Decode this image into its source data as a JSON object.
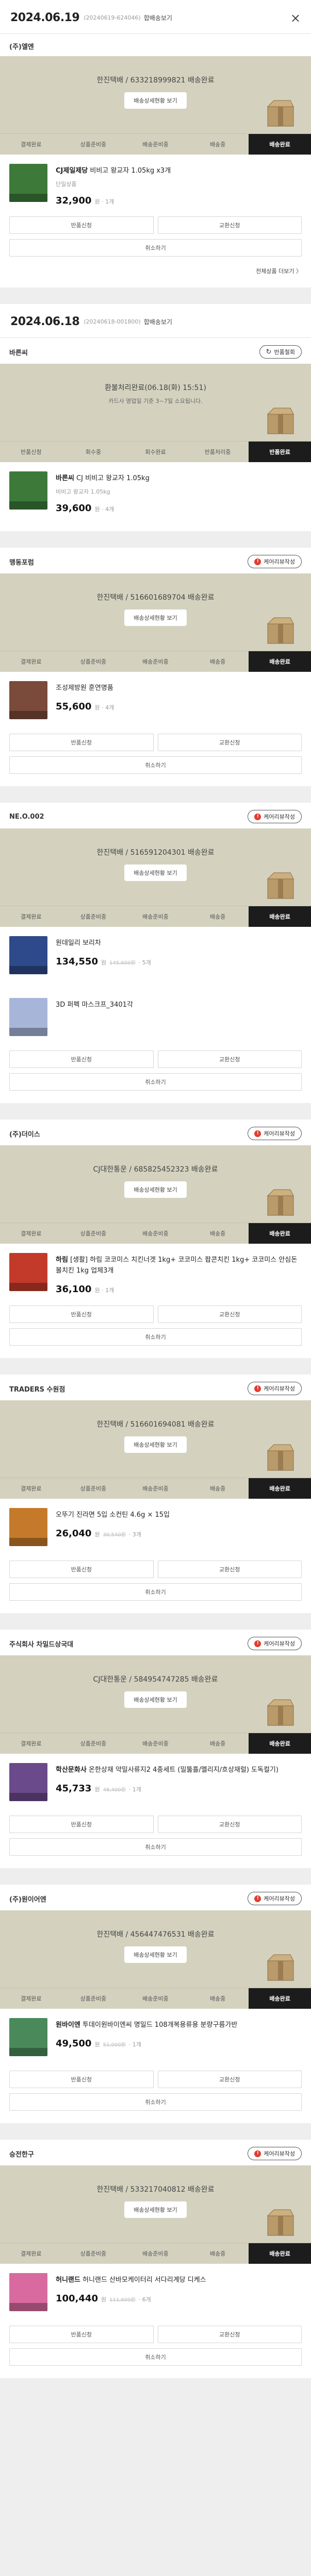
{
  "colors": {
    "banner": "#d4d2bf",
    "active_step": "#1c1c1c",
    "badge": "#e33b2e"
  },
  "orders": [
    {
      "date": "2024.06.19",
      "order_no": "(20240619-624046)",
      "detail_label": "합배송보기",
      "close_icon": "×",
      "seller": "(주)엘엔",
      "banner_status": "한진택배 / 633218999821 배송완료",
      "banner_button": "배송상세현황 보기",
      "steps": [
        "결제완료",
        "상품준비중",
        "배송준비중",
        "배송중",
        "배송완료"
      ],
      "item_name_bold": "CJ제일제당",
      "item_name": "비비고 왕교자 1.05kg x3개",
      "item_option": "단일상품",
      "item_price": "32,900",
      "item_unit": "원 · 1개",
      "btn_return": "반품신청",
      "btn_exchange": "교환신청",
      "btn_cancel": "취소하기",
      "more_link": "전체상품 더보기 〉",
      "thumb_color": "#3d7a3a"
    },
    {
      "date": "2024.06.18",
      "order_no": "(20240618-001800)",
      "detail_label": "합배송보기",
      "chip_label": "반품철회",
      "seller": "바른씨",
      "banner_status": "환불처리완료(06.18(화) 15:51)",
      "banner_sub": "카드사 영업일 기준 3~7일 소요됩니다.",
      "steps": [
        "반품신청",
        "회수중",
        "회수완료",
        "반품처리중",
        "반품완료"
      ],
      "item_name_bold": "바른씨",
      "item_name": "CJ 비비고 왕교자 1.05kg",
      "item_option": "비비고 왕교자 1.05kg",
      "item_price": "39,600",
      "item_unit": "원 · 4개",
      "thumb_color": "#3d7a3a"
    },
    {
      "seller": "맹동포럼",
      "chip_label": "케어리뷰작성",
      "banner_status": "한진택배 / 516601689704 배송완료",
      "banner_button": "배송상세현황 보기",
      "steps": [
        "결제완료",
        "상품준비중",
        "배송준비중",
        "배송중",
        "배송완료"
      ],
      "item_name": "조성제방원 훈연명품",
      "item_price": "55,600",
      "item_unit": "원 · 4개",
      "btn_return": "반품신청",
      "btn_exchange": "교환신청",
      "btn_cancel": "취소하기",
      "thumb_color": "#7a4a3a"
    },
    {
      "seller": "NE.O.002",
      "chip_label": "케어리뷰작성",
      "banner_status": "한진택배 / 516591204301 배송완료",
      "banner_button": "배송상세현황 보기",
      "steps": [
        "결제완료",
        "상품준비중",
        "배송준비중",
        "배송중",
        "배송완료"
      ],
      "item_name": "원데일리 보리차",
      "item_price": "134,550",
      "item_unit": "원",
      "item_orig": "145,600원",
      "item_unit2": "· 5개",
      "item2_name": "3D 퍼펙 마스크프_3401각",
      "btn_return": "반품신청",
      "btn_exchange": "교환신청",
      "btn_cancel": "취소하기",
      "thumb_color": "#2f4a8a",
      "thumb2_color": "#a7b6d8"
    },
    {
      "seller": "(주)더이스",
      "chip_label": "케어리뷰작성",
      "banner_status": "CJ대한통운 / 685825452323 배송완료",
      "banner_button": "배송상세현황 보기",
      "steps": [
        "결제완료",
        "상품준비중",
        "배송준비중",
        "배송중",
        "배송완료"
      ],
      "item_name_bold": "하림",
      "item_name": "[생활] 하림 코코미스 치킨너겟 1kg+ 코코미스 팝콘치킨 1kg+ 코코미스 안심돈볼치킨 1kg 업체3개",
      "item_price": "36,100",
      "item_unit": "원 · 1개",
      "btn_return": "반품신청",
      "btn_exchange": "교환신청",
      "btn_cancel": "취소하기",
      "thumb_color": "#c33a2a"
    },
    {
      "seller": "TRADERS 수원점",
      "chip_label": "케어리뷰작성",
      "banner_status": "한진택배 / 516601694081 배송완료",
      "banner_button": "배송상세현황 보기",
      "steps": [
        "결제완료",
        "상품준비중",
        "배송준비중",
        "배송중",
        "배송완료"
      ],
      "item_name": "오뚜기 진라면 5입 소컨틴 4.6g × 15입",
      "item_price": "26,040",
      "item_unit": "원",
      "item_orig": "30,540원",
      "item_unit2": "· 3개",
      "btn_return": "반품신청",
      "btn_exchange": "교환신청",
      "btn_cancel": "취소하기",
      "thumb_color": "#c47a2a"
    },
    {
      "seller": "주식회사 차밀드상국대",
      "chip_label": "케어리뷰작성",
      "banner_status": "CJ대한통운 / 584954747285 배송완료",
      "banner_button": "배송상세현황 보기",
      "steps": [
        "결제완료",
        "상품준비중",
        "배송준비중",
        "배송중",
        "배송완료"
      ],
      "item_name_bold": "학산문화사",
      "item_name": "온한상재 약밀사류지2 4종세트 (밀뚫흘/멜리지/흐상재럴) 도독컬기)",
      "item_price": "45,733",
      "item_unit": "원",
      "item_orig": "48,400원",
      "item_unit2": "· 1개",
      "btn_return": "반품신청",
      "btn_exchange": "교환신청",
      "btn_cancel": "취소하기",
      "thumb_color": "#6a4a8a"
    },
    {
      "seller": "(주)원이어엔",
      "chip_label": "케어리뷰작성",
      "banner_status": "한진택배 / 456447476531 배송완료",
      "banner_button": "배송상세현황 보기",
      "steps": [
        "결제완료",
        "상품준비중",
        "배송준비중",
        "배송중",
        "배송완료"
      ],
      "item_name_bold": "원바이엔",
      "item_name": "투데이원바이엔씨 명일드 108개복용류용 분량구름가반",
      "item_price": "49,500",
      "item_unit": "원",
      "item_orig": "51,000원",
      "item_unit2": "· 1개",
      "btn_return": "반품신청",
      "btn_exchange": "교환신청",
      "btn_cancel": "취소하기",
      "thumb_color": "#4a8a5a"
    },
    {
      "seller": "승전한구",
      "chip_label": "케어리뷰작성",
      "banner_status": "한진택배 / 533217040812 배송완료",
      "banner_button": "배송상세현황 보기",
      "steps": [
        "결제완료",
        "상품준비중",
        "배송준비중",
        "배송중",
        "배송완료"
      ],
      "item_name_bold": "허니랜드",
      "item_name": "허니랜드 산바모케이터리 서다리계당 디케스",
      "item_price": "100,440",
      "item_unit": "원",
      "item_orig": "111,600원",
      "item_unit2": "· 6개",
      "btn_return": "반품신청",
      "btn_exchange": "교환신청",
      "btn_cancel": "취소하기",
      "thumb_color": "#d86aa0"
    }
  ]
}
